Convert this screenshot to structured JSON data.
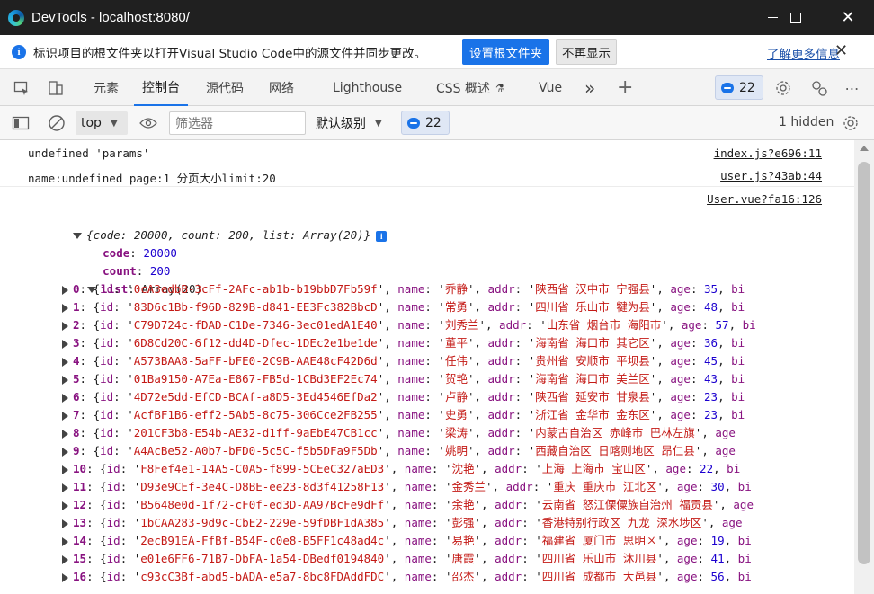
{
  "window": {
    "title": "DevTools - localhost:8080/",
    "minimize_icon": "minimize-icon",
    "maximize_icon": "maximize-icon",
    "close_icon": "close-icon"
  },
  "infobar": {
    "message": "标识项目的根文件夹以打开Visual Studio Code中的源文件并同步更改。",
    "primary_button": "设置根文件夹",
    "secondary_button": "不再显示",
    "learn_more": "了解更多信息",
    "close_glyph": "✕"
  },
  "tabs": {
    "items": [
      "元素",
      "控制台",
      "源代码",
      "网络",
      "Lighthouse",
      "CSS 概述",
      "Vue"
    ],
    "active": "控制台",
    "more_glyph": "»",
    "add_glyph": "+",
    "issues_count": "22"
  },
  "console_toolbar": {
    "context": "top",
    "filter_placeholder": "筛选器",
    "level": "默认级别",
    "issues_count": "22",
    "hidden": "1 hidden"
  },
  "console": {
    "messages": [
      {
        "text": "undefined 'params'",
        "source": "index.js?e696:11"
      },
      {
        "text": "name:undefined page:1 分页大小limit:20",
        "source": "user.js?43ab:44"
      },
      {
        "source": "User.vue?fa16:126"
      }
    ],
    "object_summary": "{code: 20000, count: 200, list: Array(20)}",
    "code_line": {
      "key": "code",
      "value": "20000"
    },
    "count_line": {
      "key": "count",
      "value": "200"
    },
    "list_line": {
      "key": "list",
      "value": "Array(20)"
    },
    "items": [
      {
        "index": "0",
        "id": "0cA3edbB-3cFf-2AFc-ab1b-b19bbD7Fb59f",
        "name": "乔静",
        "addr": "陕西省 汉中市 宁强县",
        "age": "35"
      },
      {
        "index": "1",
        "id": "83D6c1Bb-f96D-829B-d841-EE3Fc382BbcD",
        "name": "常勇",
        "addr": "四川省 乐山市 犍为县",
        "age": "48"
      },
      {
        "index": "2",
        "id": "C79D724c-fDAD-C1De-7346-3ec01edA1E40",
        "name": "刘秀兰",
        "addr": "山东省 烟台市 海阳市",
        "age": "57"
      },
      {
        "index": "3",
        "id": "6D8Cd20C-6f12-dd4D-Dfec-1DEc2e1be1de",
        "name": "董平",
        "addr": "海南省 海口市 其它区",
        "age": "36"
      },
      {
        "index": "4",
        "id": "A573BAA8-5aFF-bFE0-2C9B-AAE48cF42D6d",
        "name": "任伟",
        "addr": "贵州省 安顺市 平坝县",
        "age": "45"
      },
      {
        "index": "5",
        "id": "01Ba9150-A7Ea-E867-FB5d-1CBd3EF2Ec74",
        "name": "贺艳",
        "addr": "海南省 海口市 美兰区",
        "age": "43"
      },
      {
        "index": "6",
        "id": "4D72e5dd-EfCD-BCAf-a8D5-3Ed4546EfDa2",
        "name": "卢静",
        "addr": "陕西省 延安市 甘泉县",
        "age": "23"
      },
      {
        "index": "7",
        "id": "AcfBF1B6-eff2-5Ab5-8c75-306Cce2FB255",
        "name": "史勇",
        "addr": "浙江省 金华市 金东区",
        "age": "23"
      },
      {
        "index": "8",
        "id": "201CF3b8-E54b-AE32-d1ff-9aEbE47CB1cc",
        "name": "梁涛",
        "addr": "内蒙古自治区 赤峰市 巴林左旗",
        "age": ""
      },
      {
        "index": "9",
        "id": "A4AcBe52-A0b7-bFD0-5c5C-f5b5DFa9F5Db",
        "name": "姚明",
        "addr": "西藏自治区 日喀则地区 昂仁县",
        "age": ""
      },
      {
        "index": "10",
        "id": "F8Fef4e1-14A5-C0A5-f899-5CEeC327aED3",
        "name": "沈艳",
        "addr": "上海 上海市 宝山区",
        "age": "22"
      },
      {
        "index": "11",
        "id": "D93e9CEf-3e4C-D8BE-ee23-8d3f41258F13",
        "name": "金秀兰",
        "addr": "重庆 重庆市 江北区",
        "age": "30"
      },
      {
        "index": "12",
        "id": "B5648e0d-1f72-cF0f-ed3D-AA97BcFe9dFf",
        "name": "余艳",
        "addr": "云南省 怒江傈僳族自治州 福贡县",
        "age": ""
      },
      {
        "index": "13",
        "id": "1bCAA283-9d9c-CbE2-229e-59fDBF1dA385",
        "name": "彭强",
        "addr": "香港特别行政区 九龙 深水埗区",
        "age": ""
      },
      {
        "index": "14",
        "id": "2ecB91EA-FfBf-B54F-c0e8-B5FF1c48ad4c",
        "name": "易艳",
        "addr": "福建省 厦门市 思明区",
        "age": "19"
      },
      {
        "index": "15",
        "id": "e01e6FF6-71B7-DbFA-1a54-DBedf0194840",
        "name": "唐霞",
        "addr": "四川省 乐山市 沐川县",
        "age": "41"
      },
      {
        "index": "16",
        "id": "c93cC3Bf-abd5-bADA-e5a7-8bc8FDAddFDC",
        "name": "邵杰",
        "addr": "四川省 成都市 大邑县",
        "age": "56"
      }
    ]
  }
}
